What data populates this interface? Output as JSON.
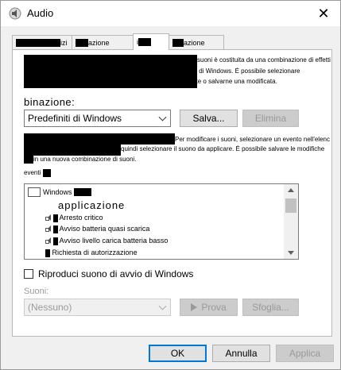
{
  "window": {
    "title": "Audio",
    "close_glyph": "✕"
  },
  "tabs": [
    {
      "label": "izi"
    },
    {
      "label": "azione"
    },
    {
      "label": "i"
    },
    {
      "label": "azione"
    }
  ],
  "description_lines": [
    "suoni è costituita da una combinazione di effetti",
    "ad eventi di programmi e di Windows. È possibile selezionare",
    "una combinazione esistente o salvarne una modificata."
  ],
  "scheme": {
    "label": "binazione:",
    "selected": "Predefiniti di Windows",
    "save_button": "Salva...",
    "delete_button": "Elimina"
  },
  "instructions": {
    "line1": "Per modificare i suoni, selezionare un evento nell'elenco che segue,",
    "line2": "quindi selezionare il suono da applicare. È possibile salvare le modifiche",
    "line3": "in una nuova combinazione di suoni.",
    "events_label": "eventi"
  },
  "events": {
    "root": "Windows",
    "group_title": "applicazione",
    "items": [
      {
        "label": "Arresto critico"
      },
      {
        "label": "Avviso batteria quasi scarica"
      },
      {
        "label": "Avviso livello carica batteria basso"
      },
      {
        "label": "Richiesta di autorizzazione"
      }
    ]
  },
  "startup": {
    "label": "Riproduci suono di avvio di Windows",
    "checked": false
  },
  "sounds": {
    "label": "Suoni:",
    "selected": "(Nessuno)",
    "play_button": "Prova",
    "browse_button": "Sfoglia..."
  },
  "footer": {
    "ok": "OK",
    "cancel": "Annulla",
    "apply": "Applica"
  },
  "colors": {
    "accent": "#0078d7",
    "disabled_text": "#9a9a9a"
  }
}
